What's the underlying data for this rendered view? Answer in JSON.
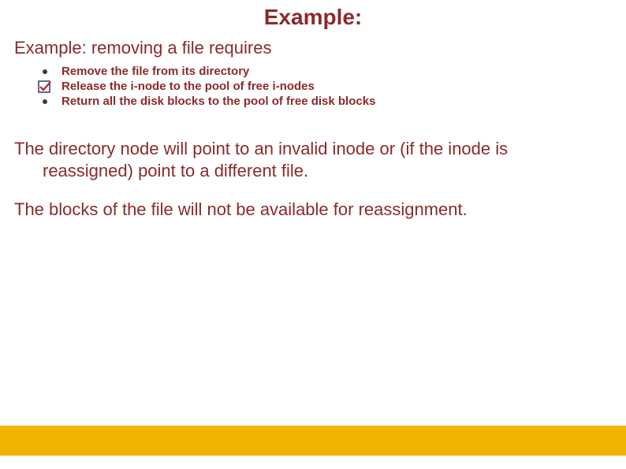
{
  "title": "Example:",
  "subtitle": "Example: removing a file requires",
  "bullets": [
    "Remove the file from its directory",
    "Release the i-node to the pool of free i-nodes",
    "Return all the disk blocks to the pool of free disk blocks"
  ],
  "paragraph1_a": "The directory node will point to an invalid inode or (if the inode is",
  "paragraph1_b": "reassigned) point to a different file.",
  "paragraph2": "The blocks of the file will not be available for  reassignment."
}
